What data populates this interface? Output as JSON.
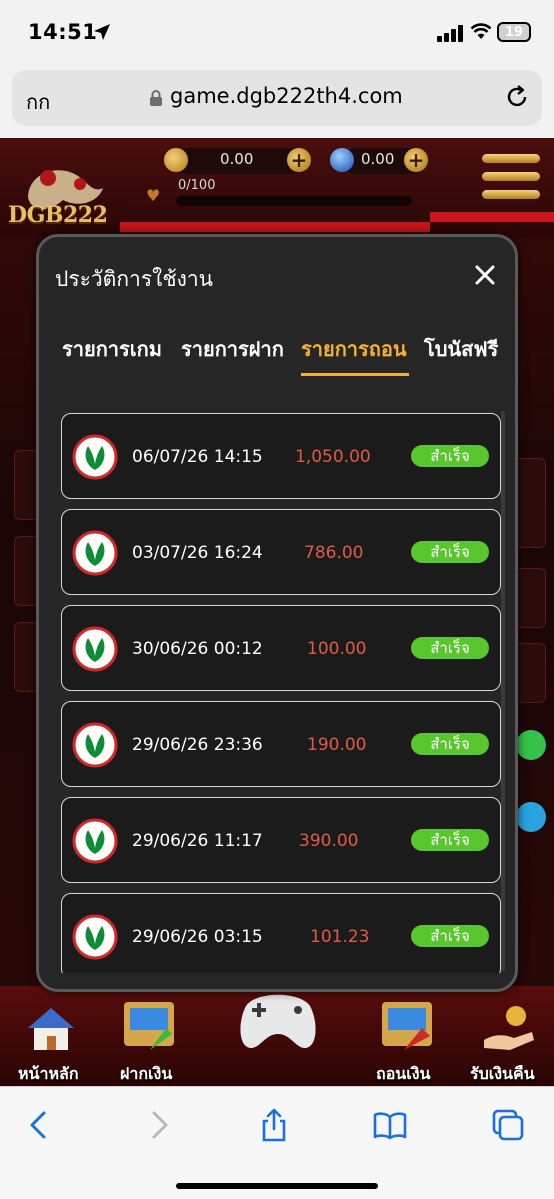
{
  "status_bar": {
    "time": "14:51",
    "battery": "19"
  },
  "browser": {
    "aa_label": "กก",
    "url": "game.dgb222th4.com"
  },
  "game_header": {
    "logo_text": "DGB222",
    "coin_balance": "0.00",
    "gem_balance": "0.00",
    "xp": "0/100",
    "xp_progress": 0
  },
  "modal": {
    "title": "ประวัติการใช้งาน",
    "tabs": [
      {
        "label": "รายการเกม",
        "active": false
      },
      {
        "label": "รายการฝาก",
        "active": false
      },
      {
        "label": "รายการถอน",
        "active": true
      },
      {
        "label": "โบนัสฟรี",
        "active": false
      }
    ],
    "rows": [
      {
        "date": "06/07/26 14:15",
        "amount": "1,050.00",
        "status": "สำเร็จ"
      },
      {
        "date": "03/07/26 16:24",
        "amount": "786.00",
        "status": "สำเร็จ"
      },
      {
        "date": "30/06/26 00:12",
        "amount": "100.00",
        "status": "สำเร็จ"
      },
      {
        "date": "29/06/26 23:36",
        "amount": "190.00",
        "status": "สำเร็จ"
      },
      {
        "date": "29/06/26 11:17",
        "amount": "390.00",
        "status": "สำเร็จ"
      },
      {
        "date": "29/06/26 03:15",
        "amount": "101.23",
        "status": "สำเร็จ"
      }
    ]
  },
  "bottom_nav": [
    {
      "label": "หน้าหลัก",
      "icon": "house-icon"
    },
    {
      "label": "ฝากเงิน",
      "icon": "deposit-atm-icon"
    },
    {
      "label": "",
      "icon": "game-controller-icon"
    },
    {
      "label": "ถอนเงิน",
      "icon": "withdraw-atm-icon"
    },
    {
      "label": "รับเงินคืน",
      "icon": "cashback-hand-icon"
    }
  ],
  "colors": {
    "accent_tab": "#f2b333",
    "amount": "#e05a4a",
    "status_success": "#58c62c",
    "modal_bg": "#262626"
  }
}
